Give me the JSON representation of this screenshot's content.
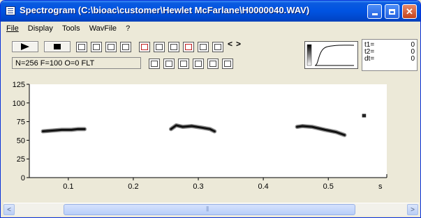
{
  "window": {
    "title": "Spectrogram (C:\\bioac\\customer\\Hewlet McFarlane\\H0000040.WAV)",
    "controls": [
      "minimize-icon",
      "maximize-icon",
      "close-icon"
    ]
  },
  "menu": {
    "items": [
      "File",
      "Display",
      "Tools",
      "WavFile",
      "?"
    ]
  },
  "toolbar": {
    "info_text": "N=256 F=100 O=0 FLT",
    "buttons": [
      "play-icon",
      "stop-icon",
      "copy-icon",
      "save-icon",
      "export-icon",
      "peak-icon",
      "settings-icon",
      "select-icon",
      "zoom-icon",
      "compare-icon",
      "print-icon",
      "open-icon",
      "prev-icon",
      "next-icon",
      "band1-icon",
      "band2-icon",
      "band3-icon",
      "band4-icon",
      "band5-icon",
      "edit-icon"
    ],
    "prev_next": [
      "<",
      ">"
    ]
  },
  "readout": {
    "t1_label": "t1=",
    "t1_value": "0",
    "t2_label": "t2=",
    "t2_value": "0",
    "dt_label": "dt=",
    "dt_value": "0"
  },
  "spectrogram": {
    "y_ticks": [
      "125",
      "100",
      "75",
      "50",
      "25",
      "0"
    ],
    "x_ticks": [
      "0.1",
      "0.2",
      "0.3",
      "0.4",
      "0.5"
    ],
    "x_unit": "s",
    "y_range": [
      0,
      125
    ],
    "x_range": [
      0.04,
      0.59
    ],
    "calls": [
      {
        "t": [
          0.061,
          0.075,
          0.09,
          0.105,
          0.115,
          0.125
        ],
        "f": [
          62,
          63,
          64,
          64,
          65,
          65
        ]
      },
      {
        "t": [
          0.258,
          0.266,
          0.276,
          0.29,
          0.305,
          0.318,
          0.325
        ],
        "f": [
          65,
          70,
          68,
          69,
          67,
          65,
          62
        ]
      },
      {
        "t": [
          0.452,
          0.46,
          0.475,
          0.495,
          0.512,
          0.525
        ],
        "f": [
          68,
          69,
          68,
          64,
          61,
          57
        ]
      },
      {
        "t": [
          0.552,
          0.558
        ],
        "f": [
          83,
          83
        ]
      }
    ]
  },
  "scrollbar": {
    "left_arrow": "<",
    "right_arrow": ">"
  }
}
